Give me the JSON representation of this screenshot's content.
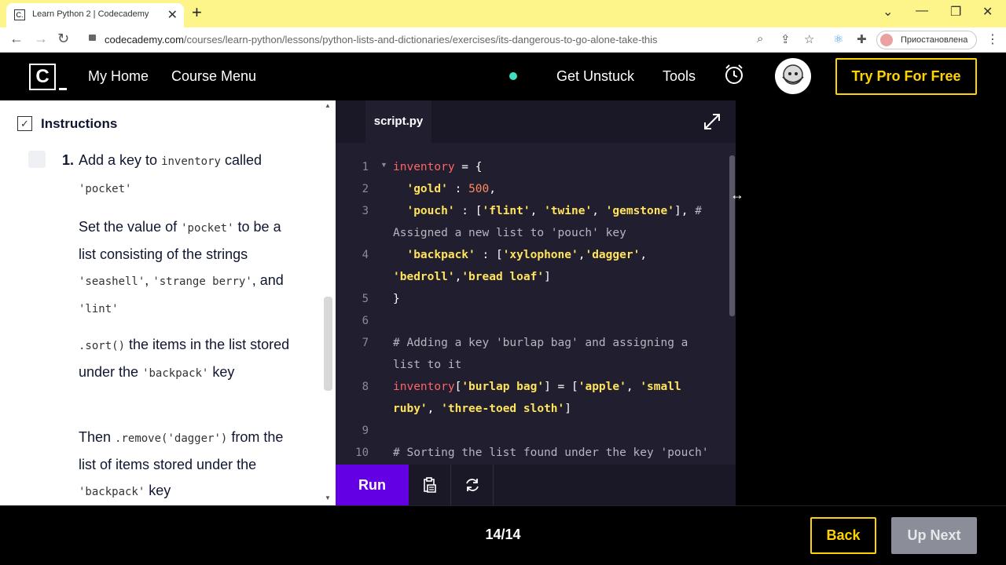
{
  "browser": {
    "tab_title": "Learn Python 2 | Codecademy",
    "favicon_text": "C.",
    "url_domain": "codecademy.com",
    "url_path": "/courses/learn-python/lessons/python-lists-and-dictionaries/exercises/its-dangerous-to-go-alone-take-this",
    "profile_label": "Приостановлена"
  },
  "header": {
    "logo_text": "C",
    "nav": [
      "My Home",
      "Course Menu"
    ],
    "get_unstuck": "Get Unstuck",
    "tools": "Tools",
    "try_pro": "Try Pro For Free",
    "accent": "#ffd300"
  },
  "instructions": {
    "title": "Instructions",
    "check_glyph": "✓",
    "task_number": "1.",
    "paragraphs": [
      [
        {
          "t": "Add a key to "
        },
        {
          "c": "inventory"
        },
        {
          "t": " called "
        },
        {
          "c": "'pocket'"
        }
      ],
      [
        {
          "t": "Set the value of "
        },
        {
          "c": "'pocket'"
        },
        {
          "t": " to be a list consisting of the strings "
        },
        {
          "c": "'seashell'"
        },
        {
          "t": ", "
        },
        {
          "c": "'strange berry'"
        },
        {
          "t": ", and "
        },
        {
          "c": "'lint'"
        }
      ],
      [
        {
          "c": ".sort()"
        },
        {
          "t": " the items in the list stored under the "
        },
        {
          "c": "'backpack'"
        },
        {
          "t": " key"
        }
      ],
      [
        {
          "t": "Then "
        },
        {
          "c": ".remove('dagger')"
        },
        {
          "t": " from the list of items stored under the "
        },
        {
          "c": "'backpack'"
        },
        {
          "t": " key"
        }
      ]
    ]
  },
  "editor": {
    "filename": "script.py",
    "lines": [
      {
        "n": "1",
        "fold": true,
        "tokens": [
          [
            "var",
            "inventory"
          ],
          [
            "op",
            " = {"
          ]
        ]
      },
      {
        "n": "2",
        "tokens": [
          [
            "op",
            "  "
          ],
          [
            "str",
            "'gold'"
          ],
          [
            "op",
            " : "
          ],
          [
            "num",
            "500"
          ],
          [
            "op",
            ","
          ]
        ]
      },
      {
        "n": "3",
        "tokens": [
          [
            "op",
            "  "
          ],
          [
            "str",
            "'pouch'"
          ],
          [
            "op",
            " : ["
          ],
          [
            "str",
            "'flint'"
          ],
          [
            "op",
            ", "
          ],
          [
            "str",
            "'twine'"
          ],
          [
            "op",
            ", "
          ],
          [
            "str",
            "'gemstone'"
          ],
          [
            "op",
            "], "
          ],
          [
            "com",
            "# Assigned a new list to 'pouch' key"
          ]
        ]
      },
      {
        "n": "4",
        "tokens": [
          [
            "op",
            "  "
          ],
          [
            "str",
            "'backpack'"
          ],
          [
            "op",
            " : ["
          ],
          [
            "str",
            "'xylophone'"
          ],
          [
            "op",
            ","
          ],
          [
            "str",
            "'dagger'"
          ],
          [
            "op",
            ", "
          ],
          [
            "str",
            "'bedroll'"
          ],
          [
            "op",
            ","
          ],
          [
            "str",
            "'bread loaf'"
          ],
          [
            "op",
            "]"
          ]
        ]
      },
      {
        "n": "5",
        "tokens": [
          [
            "op",
            "}"
          ]
        ]
      },
      {
        "n": "6",
        "tokens": []
      },
      {
        "n": "7",
        "tokens": [
          [
            "com",
            "# Adding a key 'burlap bag' and assigning a list to it"
          ]
        ]
      },
      {
        "n": "8",
        "tokens": [
          [
            "var",
            "inventory"
          ],
          [
            "op",
            "["
          ],
          [
            "str",
            "'burlap bag'"
          ],
          [
            "op",
            "] = ["
          ],
          [
            "str",
            "'apple'"
          ],
          [
            "op",
            ", "
          ],
          [
            "str",
            "'small ruby'"
          ],
          [
            "op",
            ", "
          ],
          [
            "str",
            "'three-toed sloth'"
          ],
          [
            "op",
            "]"
          ]
        ]
      },
      {
        "n": "9",
        "tokens": []
      },
      {
        "n": "10",
        "tokens": [
          [
            "com",
            "# Sorting the list found under the key 'pouch'"
          ]
        ]
      }
    ],
    "run_label": "Run"
  },
  "footer": {
    "progress": "14/14",
    "back": "Back",
    "next": "Up Next"
  }
}
